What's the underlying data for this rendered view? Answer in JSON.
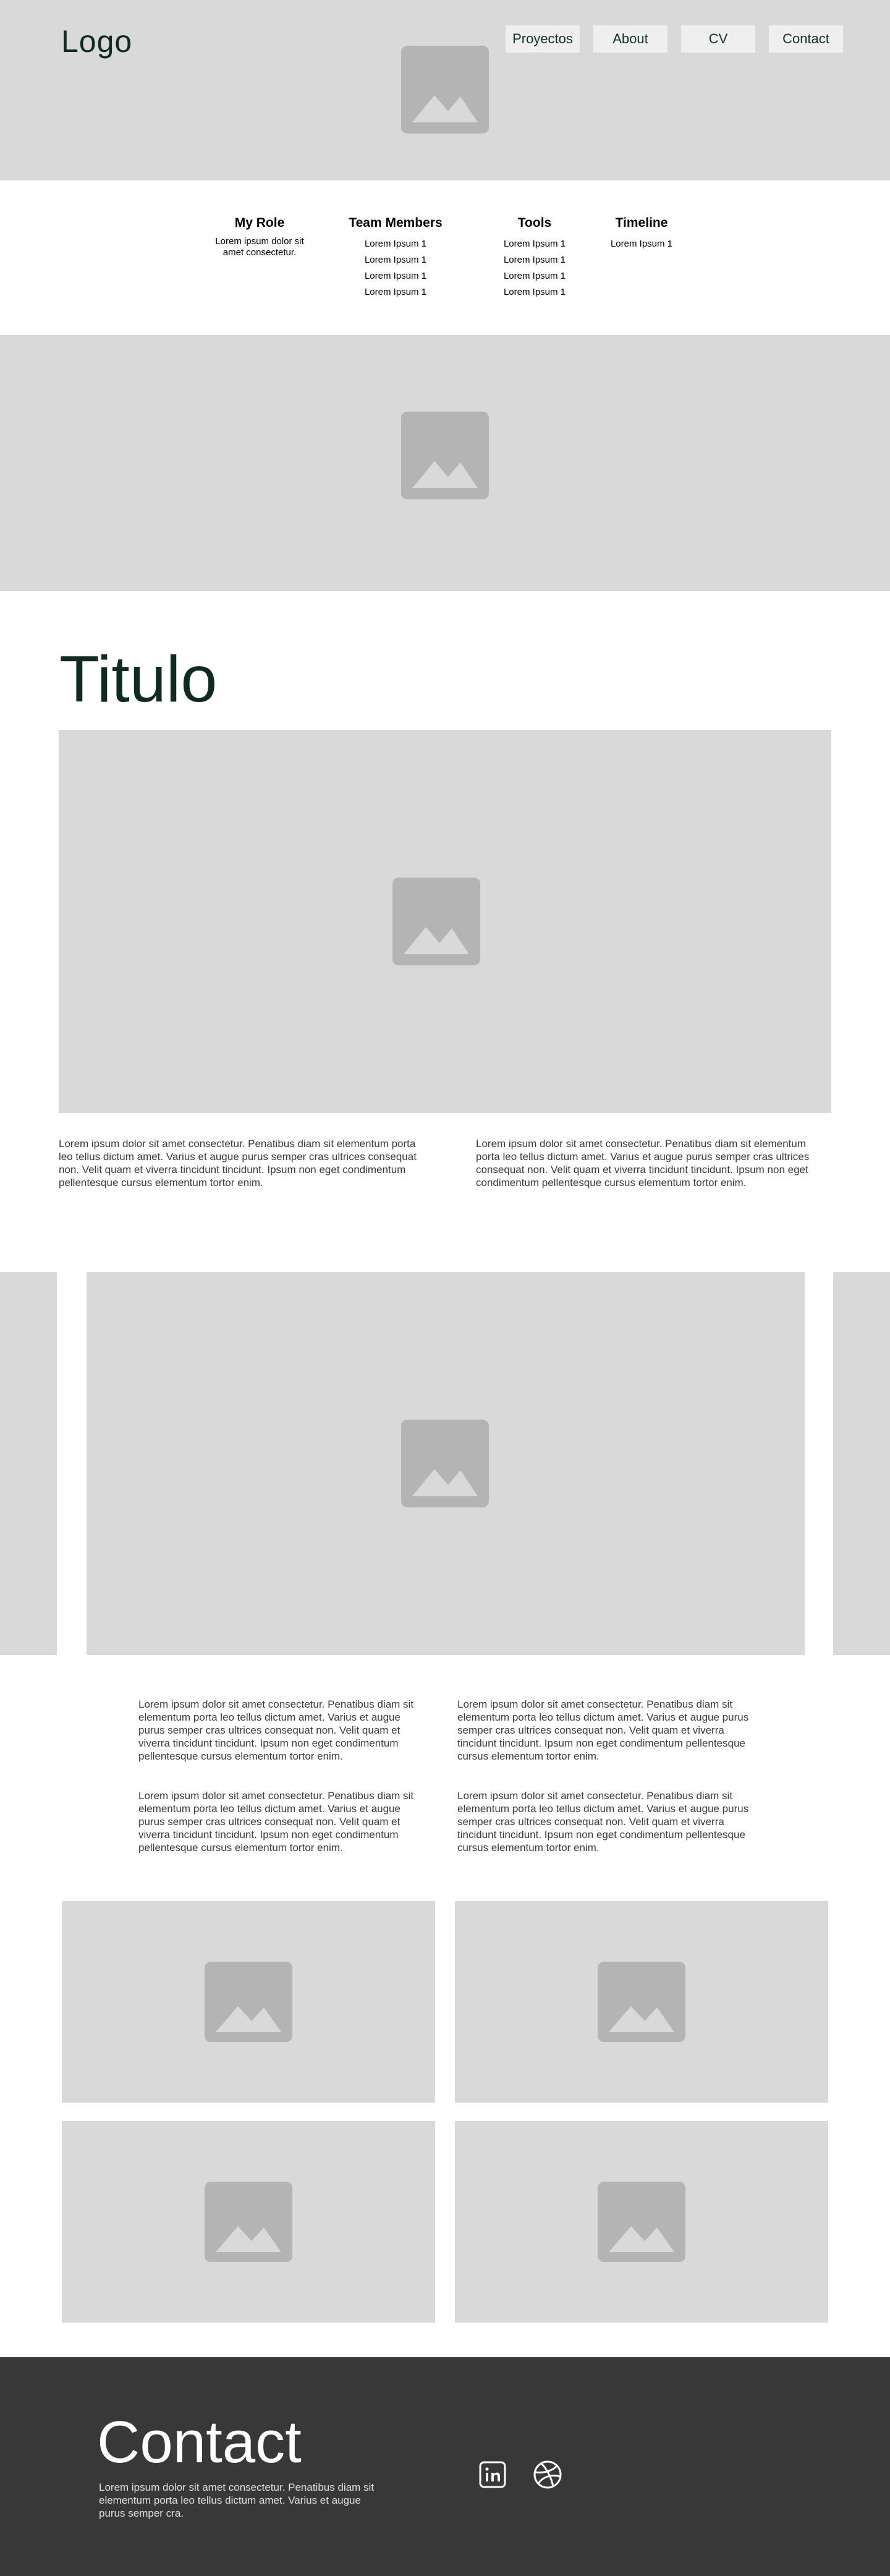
{
  "header": {
    "logo": "Logo",
    "nav": [
      {
        "label": "Proyectos"
      },
      {
        "label": "About"
      },
      {
        "label": "CV"
      },
      {
        "label": "Contact"
      }
    ]
  },
  "info": {
    "columns": [
      {
        "heading": "My Role",
        "items": [
          "Lorem ipsum dolor sit amet consectetur."
        ]
      },
      {
        "heading": "Team Members",
        "items": [
          "Lorem Ipsum 1",
          "Lorem Ipsum 1",
          "Lorem Ipsum 1",
          "Lorem Ipsum 1"
        ]
      },
      {
        "heading": "Tools",
        "items": [
          "Lorem Ipsum 1",
          "Lorem Ipsum 1",
          "Lorem Ipsum 1",
          "Lorem Ipsum 1"
        ]
      },
      {
        "heading": "Timeline",
        "items": [
          "Lorem Ipsum 1"
        ]
      }
    ]
  },
  "main": {
    "title": "Titulo",
    "intro_paragraphs": [
      "Lorem ipsum dolor sit amet consectetur. Penatibus diam sit elementum porta leo tellus dictum amet. Varius et augue purus semper cras ultrices consequat non. Velit quam et viverra tincidunt tincidunt. Ipsum non eget condimentum pellentesque cursus elementum tortor enim.",
      "Lorem ipsum dolor sit amet consectetur. Penatibus diam sit elementum porta leo tellus dictum amet. Varius et augue purus semper cras ultrices consequat non. Velit quam et viverra tincidunt tincidunt. Ipsum non eget condimentum pellentesque cursus elementum tortor enim."
    ],
    "grid_paragraphs": [
      "Lorem ipsum dolor sit amet consectetur. Penatibus diam sit elementum porta leo tellus dictum amet. Varius et augue purus semper cras ultrices consequat non. Velit quam et viverra tincidunt tincidunt. Ipsum non eget condimentum pellentesque cursus elementum tortor enim.",
      "Lorem ipsum dolor sit amet consectetur. Penatibus diam sit elementum porta leo tellus dictum amet. Varius et augue purus semper cras ultrices consequat non. Velit quam et viverra tincidunt tincidunt. Ipsum non eget condimentum pellentesque cursus elementum tortor enim.",
      "Lorem ipsum dolor sit amet consectetur. Penatibus diam sit elementum porta leo tellus dictum amet. Varius et augue purus semper cras ultrices consequat non. Velit quam et viverra tincidunt tincidunt. Ipsum non eget condimentum pellentesque cursus elementum tortor enim.",
      "Lorem ipsum dolor sit amet consectetur. Penatibus diam sit elementum porta leo tellus dictum amet. Varius et augue purus semper cras ultrices consequat non. Velit quam et viverra tincidunt tincidunt. Ipsum non eget condimentum pellentesque cursus elementum tortor enim."
    ]
  },
  "footer": {
    "title": "Contact",
    "text": "Lorem ipsum dolor sit amet consectetur. Penatibus diam sit elementum porta leo tellus dictum amet. Varius et augue purus semper cra.",
    "social": [
      {
        "icon": "linkedin-icon"
      },
      {
        "icon": "dribbble-icon"
      }
    ]
  },
  "colors": {
    "placeholder_bg": "#d9d9d9",
    "placeholder_icon": "#b4b4b4",
    "nav_button_bg": "#efefef",
    "text_dark_green": "#0f2a1f",
    "footer_bg": "#383838"
  }
}
